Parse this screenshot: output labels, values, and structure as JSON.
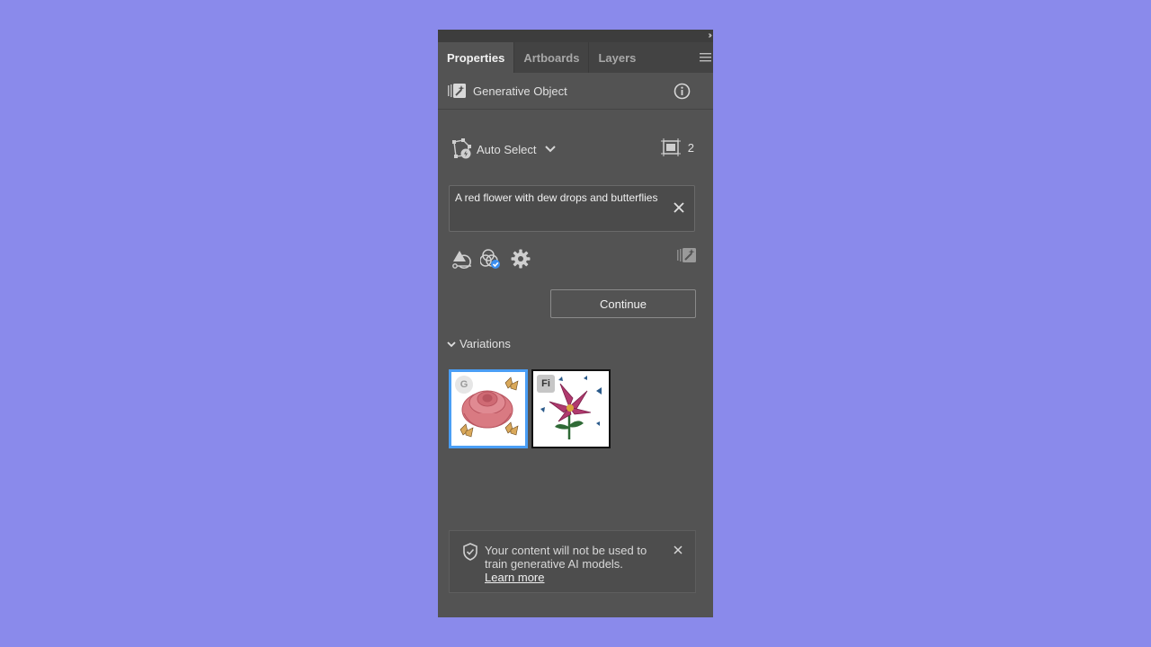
{
  "tabs": [
    {
      "label": "Properties",
      "active": true
    },
    {
      "label": "Artboards",
      "active": false
    },
    {
      "label": "Layers",
      "active": false
    }
  ],
  "header": {
    "title": "Generative Object",
    "icon": "generative-object-icon",
    "info_icon": "info-icon"
  },
  "auto_select": {
    "label": "Auto Select",
    "count": "2"
  },
  "prompt": {
    "value": "A red flower with dew drops and butterflies"
  },
  "tools": [
    "style-reference-icon",
    "color-palette-check-icon",
    "settings-gear-icon",
    "generative-object-icon"
  ],
  "continue_label": "Continue",
  "variations": {
    "label": "Variations",
    "items": [
      {
        "badge": "G",
        "selected": true
      },
      {
        "badge": "Fi",
        "selected": false
      }
    ]
  },
  "notice": {
    "message": "Your content will not be used to train generative AI models.",
    "link": "Learn more"
  },
  "colors": {
    "panel_bg": "#535353",
    "tab_bar_bg": "#434343",
    "page_bg": "#8a8aeb",
    "selection_accent": "#4a9ef5"
  }
}
